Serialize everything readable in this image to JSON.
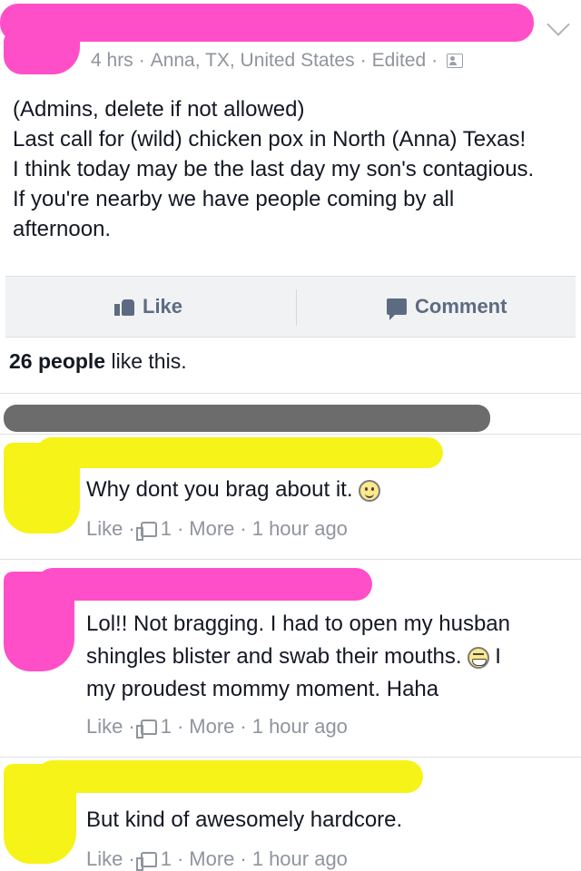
{
  "post": {
    "meta_time": "4 hrs",
    "meta_location": "Anna, TX, United States",
    "meta_edited": "Edited",
    "meta_sep": "·",
    "audience_icon": "friends-icon",
    "body_lines": [
      "(Admins, delete if not allowed)",
      "Last call for (wild) chicken pox in North (Anna) Texas!",
      "I think today may be the last day my son's contagious.",
      "If you're nearby we have people coming by all",
      "afternoon."
    ]
  },
  "actions": {
    "like_label": "Like",
    "comment_label": "Comment"
  },
  "likes_summary": {
    "count_text": "26 people",
    "suffix_text": " like this."
  },
  "comments": [
    {
      "lines": [
        "Why dont you brag about it."
      ],
      "emoji": "smile-icon",
      "like_label": "Like",
      "like_count": "1",
      "more_label": "More",
      "time": "1 hour ago"
    },
    {
      "lines": [
        "Lol!! Not bragging. I had to open my husban",
        "shingles blister and swab their mouths.",
        "my proudest mommy moment. Haha"
      ],
      "emoji": "grin-icon",
      "line2_tail": "I",
      "like_label": "Like",
      "like_count": "1",
      "more_label": "More",
      "time": "1 hour ago"
    },
    {
      "lines": [
        "But kind of awesomely hardcore."
      ],
      "like_label": "Like",
      "like_count": "1",
      "more_label": "More",
      "time": "1 hour ago"
    }
  ],
  "colors": {
    "redaction_pink": "#ff4fc8",
    "redaction_yellow": "#f6f318",
    "redaction_gray": "#6c6c6c",
    "meta_gray": "#90949c",
    "action_gray": "#5d6b82"
  }
}
